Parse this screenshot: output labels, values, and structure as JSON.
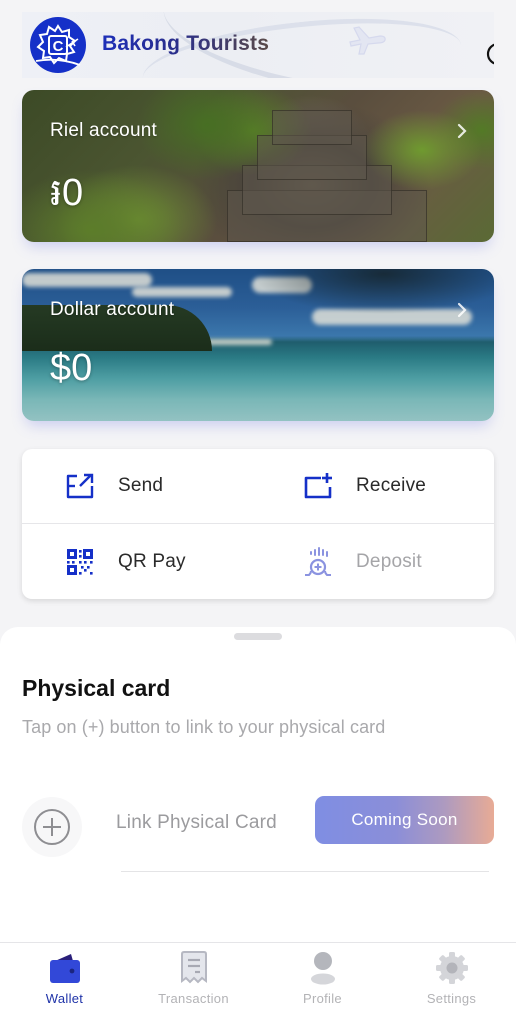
{
  "header": {
    "app_title": "Bakong Tourists",
    "logo_icon": "bakong-tourists-logo",
    "search_icon": "search-icon"
  },
  "accounts": [
    {
      "label": "Riel account",
      "amount": "៛0",
      "chevron_icon": "chevron-right-icon"
    },
    {
      "label": "Dollar account",
      "amount": "$0",
      "chevron_icon": "chevron-right-icon"
    }
  ],
  "actions": [
    {
      "label": "Send",
      "icon": "send-icon",
      "enabled": true
    },
    {
      "label": "Receive",
      "icon": "receive-icon",
      "enabled": true
    },
    {
      "label": "QR Pay",
      "icon": "qr-code-icon",
      "enabled": true
    },
    {
      "label": "Deposit",
      "icon": "deposit-icon",
      "enabled": false
    }
  ],
  "physical_card": {
    "title": "Physical card",
    "subtitle": "Tap on (+) button to link to your physical card",
    "link_label": "Link Physical Card",
    "button_label": "Coming Soon"
  },
  "tabbar": {
    "active": "Wallet",
    "tabs": [
      {
        "label": "Wallet",
        "icon": "wallet-icon"
      },
      {
        "label": "Transaction",
        "icon": "receipt-icon"
      },
      {
        "label": "Profile",
        "icon": "profile-icon"
      },
      {
        "label": "Settings",
        "icon": "gear-icon"
      }
    ]
  },
  "colors": {
    "accent": "#1530c8",
    "active_tab": "#1f33a8",
    "inactive_tab": "#b3b3b6",
    "disabled_text": "#a5a5a8",
    "coming_soon_gradient": [
      "#7f8ee3",
      "#e8ab95"
    ]
  }
}
